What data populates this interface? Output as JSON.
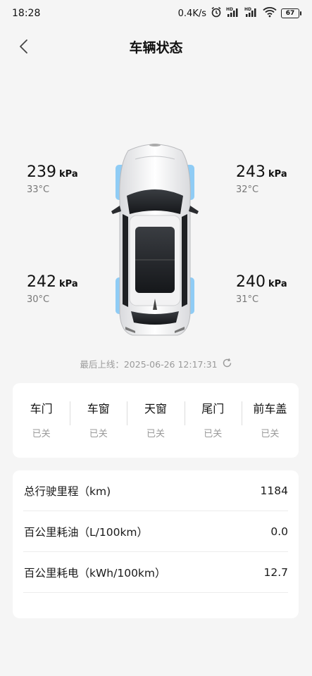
{
  "status_bar": {
    "time": "18:28",
    "speed": "0.4K/s",
    "battery": "67",
    "icons": [
      "alarm-icon",
      "hd-signal-icon",
      "hd-signal-icon",
      "wifi-icon",
      "battery-icon"
    ]
  },
  "header": {
    "title": "车辆状态",
    "back_icon": "chevron-left-icon"
  },
  "tires": {
    "front_left": {
      "pressure": "239",
      "unit": "kPa",
      "temp": "33°C"
    },
    "front_right": {
      "pressure": "243",
      "unit": "kPa",
      "temp": "32°C"
    },
    "rear_left": {
      "pressure": "242",
      "unit": "kPa",
      "temp": "30°C"
    },
    "rear_right": {
      "pressure": "240",
      "unit": "kPa",
      "temp": "31°C"
    }
  },
  "last_online": {
    "text": "最后上线：2025-06-26 12:17:31",
    "refresh_icon": "refresh-icon"
  },
  "status_items": [
    {
      "label": "车门",
      "value": "已关"
    },
    {
      "label": "车窗",
      "value": "已关"
    },
    {
      "label": "天窗",
      "value": "已关"
    },
    {
      "label": "尾门",
      "value": "已关"
    },
    {
      "label": "前车盖",
      "value": "已关"
    }
  ],
  "stats": [
    {
      "label": "总行驶里程（km)",
      "value": "1184"
    },
    {
      "label": "百公里耗油（L/100km）",
      "value": "0.0"
    },
    {
      "label": "百公里耗电（kWh/100km）",
      "value": "12.7"
    }
  ],
  "colors": {
    "background": "#f5f5f5",
    "card": "#ffffff",
    "tire_highlight": "#7cc4f4",
    "muted_text": "#9a9a9a"
  }
}
